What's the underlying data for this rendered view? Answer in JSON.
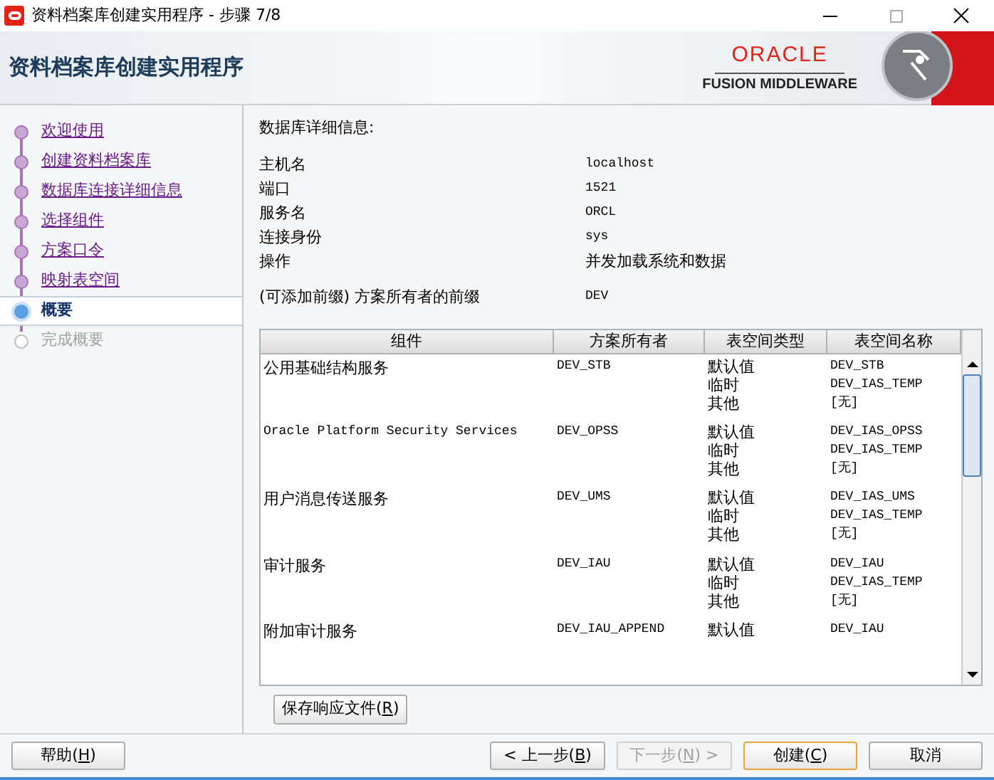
{
  "window": {
    "title": "资料档案库创建实用程序 - 步骤 7/8"
  },
  "header": {
    "title": "资料档案库创建实用程序",
    "brand": "ORACLE",
    "product": "FUSION MIDDLEWARE"
  },
  "steps": [
    {
      "label": "欢迎使用",
      "selected": false,
      "disabled": false
    },
    {
      "label": "创建资料档案库",
      "selected": false,
      "disabled": false
    },
    {
      "label": "数据库连接详细信息",
      "selected": false,
      "disabled": false
    },
    {
      "label": "选择组件",
      "selected": false,
      "disabled": false
    },
    {
      "label": "方案口令",
      "selected": false,
      "disabled": false
    },
    {
      "label": "映射表空间",
      "selected": false,
      "disabled": false
    },
    {
      "label": "概要",
      "selected": true,
      "disabled": false
    },
    {
      "label": "完成概要",
      "selected": false,
      "disabled": true
    }
  ],
  "details": {
    "heading": "数据库详细信息:",
    "fields": [
      {
        "label": "主机名",
        "value": "localhost",
        "kind": "mono"
      },
      {
        "label": "端口",
        "value": "1521",
        "kind": "mono"
      },
      {
        "label": "服务名",
        "value": "ORCL",
        "kind": "mono"
      },
      {
        "label": "连接身份",
        "value": "sys",
        "kind": "mono"
      },
      {
        "label": "操作",
        "value": "并发加载系统和数据",
        "kind": "text"
      }
    ],
    "prefix": {
      "label": "(可添加前缀) 方案所有者的前缀",
      "value": "DEV"
    }
  },
  "table": {
    "columns": [
      "组件",
      "方案所有者",
      "表空间类型",
      "表空间名称"
    ],
    "rows": [
      {
        "component": "公用基础结构服务",
        "kind": "text",
        "owner": "DEV_STB",
        "tablespaces": [
          {
            "type": "默认值",
            "name": "DEV_STB"
          },
          {
            "type": "临时",
            "name": "DEV_IAS_TEMP"
          },
          {
            "type": "其他",
            "name": "[无]"
          }
        ]
      },
      {
        "component": "Oracle Platform Security Services",
        "kind": "mono",
        "owner": "DEV_OPSS",
        "tablespaces": [
          {
            "type": "默认值",
            "name": "DEV_IAS_OPSS"
          },
          {
            "type": "临时",
            "name": "DEV_IAS_TEMP"
          },
          {
            "type": "其他",
            "name": "[无]"
          }
        ]
      },
      {
        "component": "用户消息传送服务",
        "kind": "text",
        "owner": "DEV_UMS",
        "tablespaces": [
          {
            "type": "默认值",
            "name": "DEV_IAS_UMS"
          },
          {
            "type": "临时",
            "name": "DEV_IAS_TEMP"
          },
          {
            "type": "其他",
            "name": "[无]"
          }
        ]
      },
      {
        "component": "审计服务",
        "kind": "text",
        "owner": "DEV_IAU",
        "tablespaces": [
          {
            "type": "默认值",
            "name": "DEV_IAU"
          },
          {
            "type": "临时",
            "name": "DEV_IAS_TEMP"
          },
          {
            "type": "其他",
            "name": "[无]"
          }
        ]
      },
      {
        "component": "附加审计服务",
        "kind": "text",
        "owner": "DEV_IAU_APPEND",
        "tablespaces": [
          {
            "type": "默认值",
            "name": "DEV_IAU"
          }
        ]
      }
    ]
  },
  "save_button": {
    "pre": "保存响应文件(",
    "key": "R",
    "post": ")"
  },
  "buttons": [
    {
      "kind": "help",
      "pre": "帮助(",
      "key": "H",
      "post": ")",
      "disabled": false,
      "selected": false
    },
    {
      "kind": "back",
      "pre": "< 上一步(",
      "key": "B",
      "post": ")",
      "disabled": false,
      "selected": false
    },
    {
      "kind": "next",
      "pre": "下一步(",
      "key": "N",
      "post": ") >",
      "disabled": true,
      "selected": false
    },
    {
      "kind": "create",
      "pre": "创建(",
      "key": "C",
      "post": ")",
      "disabled": false,
      "selected": true
    },
    {
      "kind": "cancel",
      "pre": "取消",
      "disabled": false,
      "selected": false
    }
  ]
}
